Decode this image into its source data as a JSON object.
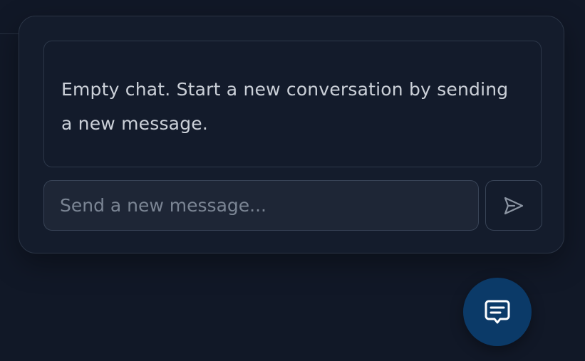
{
  "chat": {
    "empty_message": "Empty chat. Start a new conversation by sending a new message.",
    "input": {
      "value": "",
      "placeholder": "Send a new message..."
    },
    "send_icon": "send-icon"
  },
  "launcher": {
    "icon": "chat-bubble-icon"
  },
  "colors": {
    "background": "#111827",
    "panel": "#141c2c",
    "border": "#2b3546",
    "text": "#cbd0d8",
    "placeholder": "#7b8594",
    "launcher": "#0b3a68"
  }
}
